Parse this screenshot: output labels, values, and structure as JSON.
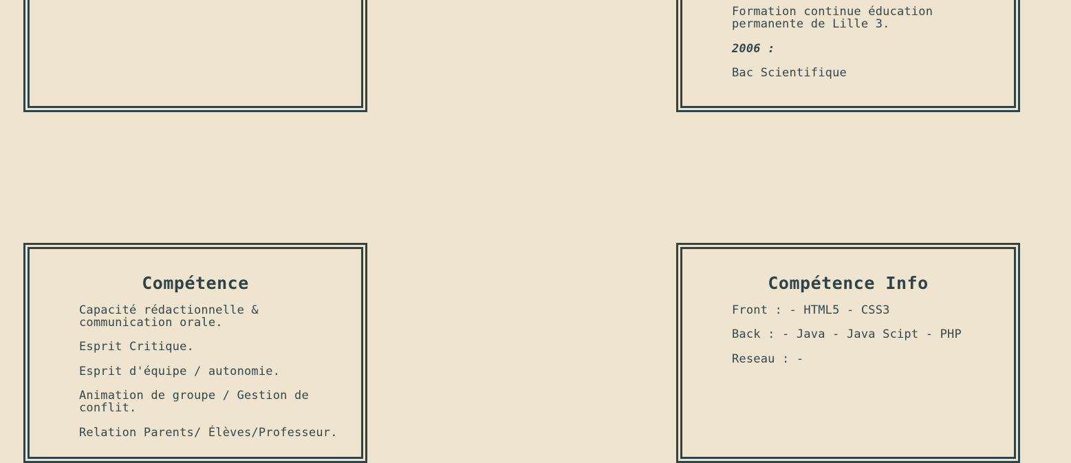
{
  "formation": {
    "line1": "Formation continue éducation",
    "line2": "permanente de Lille 3.",
    "year": "2006 :",
    "diploma": "Bac Scientifique"
  },
  "competence": {
    "title": "Compétence",
    "items": [
      "Capacité rédactionnelle &\ncommunication orale.",
      "Esprit Critique.",
      "Esprit d'équipe / autonomie.",
      "Animation de groupe / Gestion de\nconflit.",
      "Relation Parents/ Élèves/Professeur."
    ]
  },
  "competence_info": {
    "title": "Compétence Info",
    "items": [
      "Front : - HTML5 - CSS3",
      "Back : - Java - Java Scipt - PHP",
      "Reseau : -"
    ]
  }
}
